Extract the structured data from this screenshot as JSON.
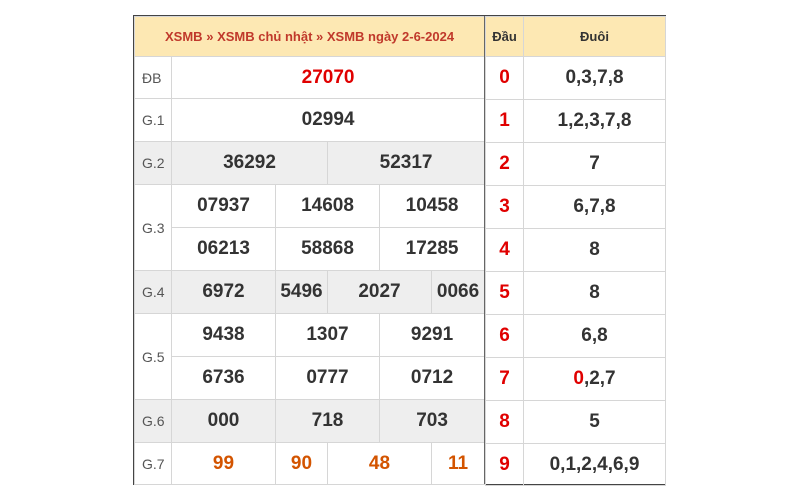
{
  "header": {
    "crumb1": "XSMB",
    "crumb2": "XSMB chủ nhật",
    "crumb3": "XSMB ngày 2-6-2024",
    "sep": "»"
  },
  "prizes": {
    "db": {
      "label": "ĐB",
      "values": [
        "27070"
      ]
    },
    "g1": {
      "label": "G.1",
      "values": [
        "02994"
      ]
    },
    "g2": {
      "label": "G.2",
      "values": [
        "36292",
        "52317"
      ]
    },
    "g3": {
      "label": "G.3",
      "values": [
        "07937",
        "14608",
        "10458",
        "06213",
        "58868",
        "17285"
      ]
    },
    "g4": {
      "label": "G.4",
      "values": [
        "6972",
        "5496",
        "2027",
        "0066"
      ]
    },
    "g5": {
      "label": "G.5",
      "values": [
        "9438",
        "1307",
        "9291",
        "6736",
        "0777",
        "0712"
      ]
    },
    "g6": {
      "label": "G.6",
      "values": [
        "000",
        "718",
        "703"
      ]
    },
    "g7": {
      "label": "G.7",
      "values": [
        "99",
        "90",
        "48",
        "11"
      ]
    }
  },
  "loto": {
    "head_label": "Đầu",
    "tail_label": "Đuôi",
    "rows": [
      {
        "head": "0",
        "tail": "0,3,7,8"
      },
      {
        "head": "1",
        "tail": "1,2,3,7,8"
      },
      {
        "head": "2",
        "tail": "7"
      },
      {
        "head": "3",
        "tail": "6,7,8"
      },
      {
        "head": "4",
        "tail": "8"
      },
      {
        "head": "5",
        "tail": "8"
      },
      {
        "head": "6",
        "tail": "6,8"
      },
      {
        "head": "7",
        "tail_highlight": "0",
        "tail_rest": ",2,7"
      },
      {
        "head": "8",
        "tail": "5"
      },
      {
        "head": "9",
        "tail": "0,1,2,4,6,9"
      }
    ]
  },
  "colors": {
    "header_bg": "#fde8b3",
    "link": "#c0392b",
    "highlight": "#e00000",
    "g7": "#d35400"
  }
}
